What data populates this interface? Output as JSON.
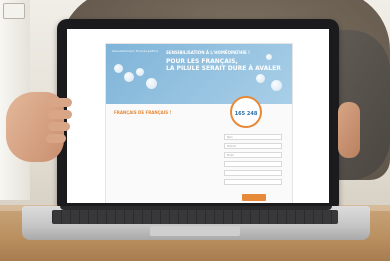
{
  "scene": {
    "description_tags": [
      "laptop",
      "hands",
      "wooden-table",
      "web-page-on-screen"
    ]
  },
  "screen_page": {
    "brand": "Sensiblement Homéopathie",
    "kicker": "SENSIBILISATION À L'HOMÉOPATHIE !",
    "headline_line1": "POUR LES FRANÇAIS,",
    "headline_line2": "LA PILULE SERAIT DURE À AVALER",
    "counter_label": "",
    "counter_value": "165 248",
    "counter_sub": "",
    "section_title": "FRANÇAIS DE FRANÇAIS !",
    "paragraphs": [
      "",
      "",
      ""
    ],
    "form_fields": [
      "Nom",
      "Prénom",
      "Email",
      "",
      "",
      ""
    ],
    "submit_label": ""
  }
}
